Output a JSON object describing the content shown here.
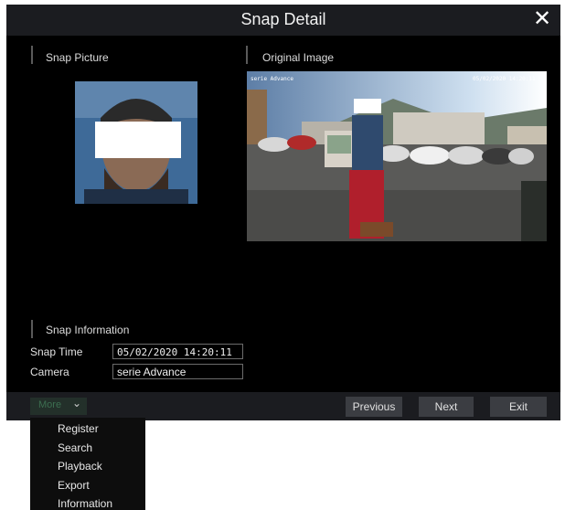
{
  "dialog": {
    "title": "Snap Detail",
    "close_glyph": "✕"
  },
  "sections": {
    "snap_picture": "Snap Picture",
    "original_image": "Original Image",
    "snap_information": "Snap Information"
  },
  "original_image": {
    "osd_text": "serie Advance",
    "osd_timestamp": "05/02/2020 14:20:11"
  },
  "fields": {
    "snap_time_label": "Snap Time",
    "snap_time_value": "05/02/2020 14:20:11",
    "camera_label": "Camera",
    "camera_value": "serie Advance"
  },
  "footer": {
    "more_label": "More",
    "previous_label": "Previous",
    "next_label": "Next",
    "exit_label": "Exit"
  },
  "more_menu": {
    "items": [
      "Register",
      "Search",
      "Playback",
      "Export",
      "Information"
    ]
  },
  "colors": {
    "dialog_bg": "#000000",
    "bar_bg": "#1b1c20",
    "button_bg": "#3b3d42",
    "more_accent": "#3c6e50"
  },
  "icons": {
    "close": "close-icon",
    "more_dropdown": "chevron-down-icon"
  }
}
